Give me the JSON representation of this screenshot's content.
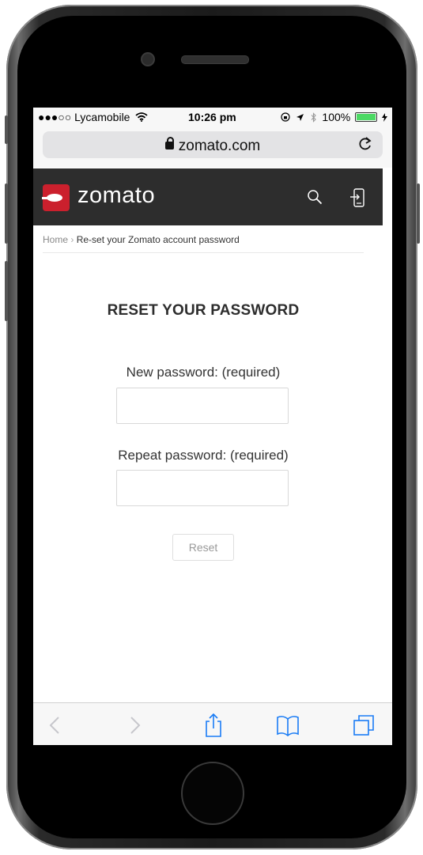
{
  "status_bar": {
    "carrier": "●●●○○ Lycamobile",
    "time": "10:26 pm",
    "battery": "100%"
  },
  "address_bar": {
    "url": "zomato.com"
  },
  "header": {
    "logo_text": "zomato"
  },
  "breadcrumb": {
    "home": "Home",
    "separator": "›",
    "current": "Re-set your Zomato account password"
  },
  "form": {
    "title": "RESET YOUR PASSWORD",
    "new_password_label": "New password: (required)",
    "new_password_value": "",
    "repeat_password_label": "Repeat password: (required)",
    "repeat_password_value": "",
    "reset_label": "Reset"
  },
  "toolbar": {
    "icons": [
      "back-icon",
      "forward-icon",
      "share-icon",
      "bookmarks-icon",
      "tabs-icon"
    ]
  },
  "colors": {
    "brand_red": "#cb202d",
    "header_bg": "#2d2d2d",
    "ios_blue": "#1a7cf5",
    "battery_green": "#4cd964"
  }
}
